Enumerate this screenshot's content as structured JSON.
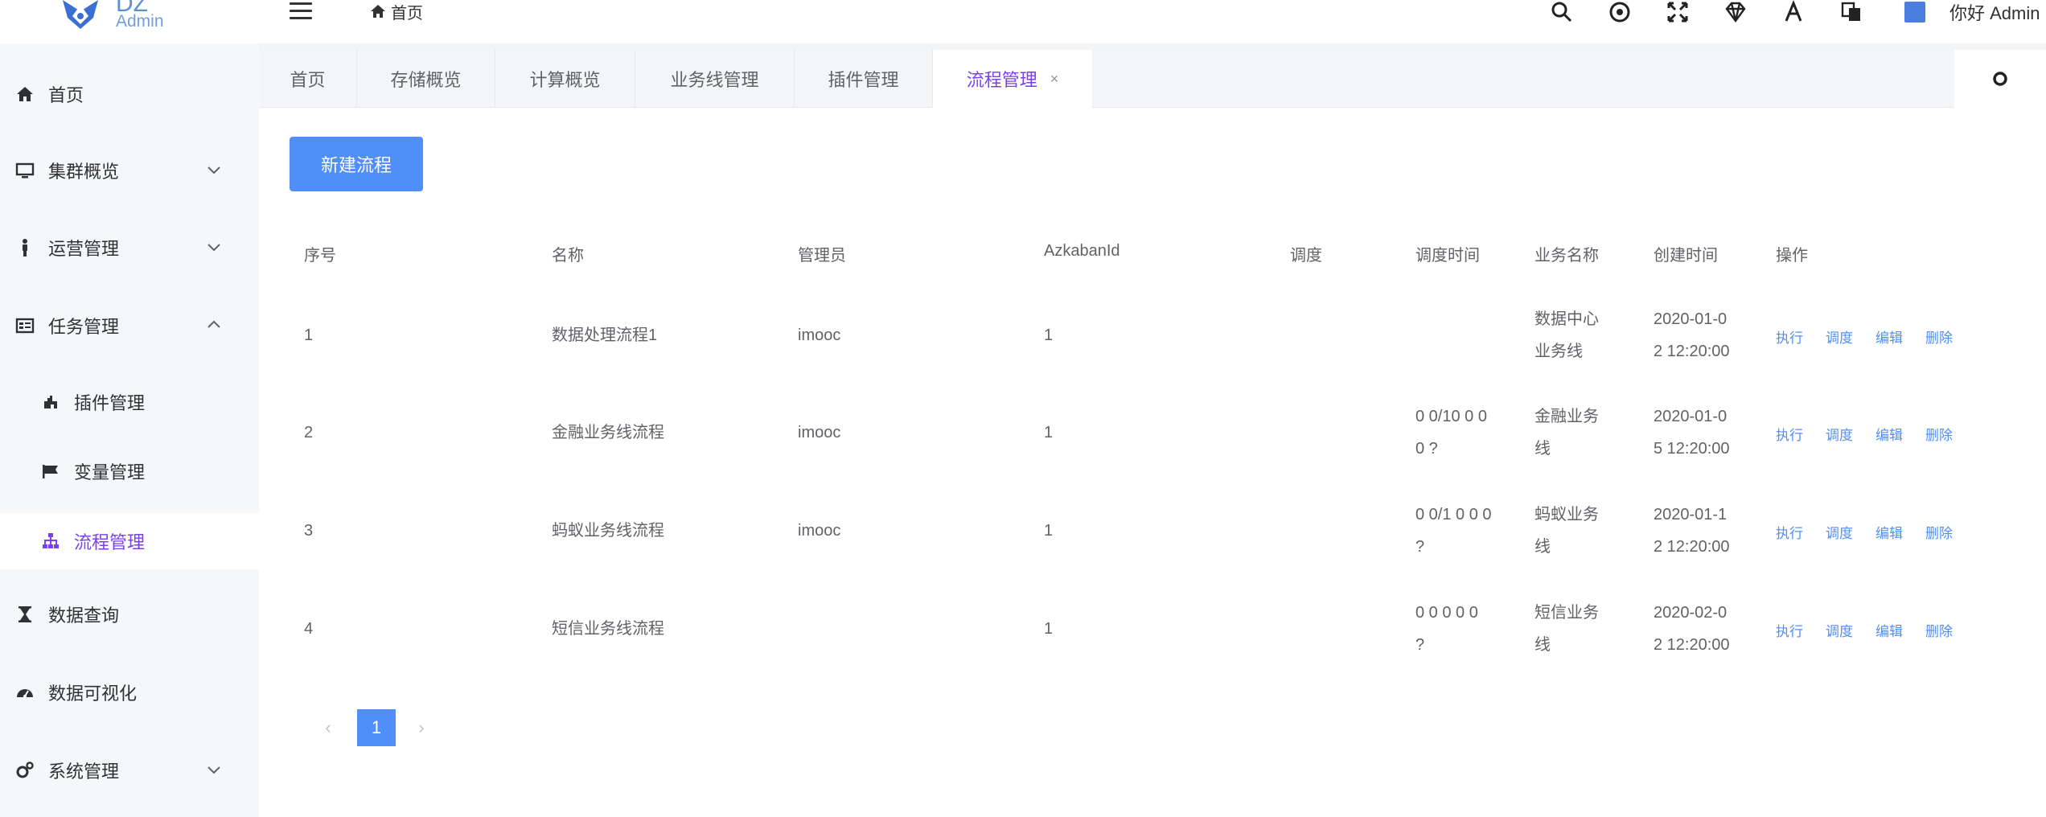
{
  "app": {
    "logo_text": "DZ",
    "logo_sub": "Admin",
    "breadcrumb": "首页",
    "greeting": "你好 Admin"
  },
  "topbar_icons": [
    "search-icon",
    "target-icon",
    "fullscreen-icon",
    "diamond-icon",
    "font-icon",
    "translate-icon"
  ],
  "sidebar": {
    "items": [
      {
        "label": "首页",
        "icon": "home-icon"
      },
      {
        "label": "集群概览",
        "icon": "monitor-icon",
        "arrow": "down"
      },
      {
        "label": "运营管理",
        "icon": "person-icon",
        "arrow": "down"
      },
      {
        "label": "任务管理",
        "icon": "task-icon",
        "arrow": "up"
      },
      {
        "label": "插件管理",
        "icon": "plugin-icon"
      },
      {
        "label": "变量管理",
        "icon": "flag-icon"
      },
      {
        "label": "流程管理",
        "icon": "sitemap-icon"
      },
      {
        "label": "数据查询",
        "icon": "hourglass-icon"
      },
      {
        "label": "数据可视化",
        "icon": "dashboard-icon"
      },
      {
        "label": "系统管理",
        "icon": "gears-icon",
        "arrow": "down"
      }
    ]
  },
  "tabs": [
    {
      "label": "首页"
    },
    {
      "label": "存储概览"
    },
    {
      "label": "计算概览"
    },
    {
      "label": "业务线管理"
    },
    {
      "label": "插件管理"
    },
    {
      "label": "流程管理",
      "close": "×"
    }
  ],
  "main": {
    "new_button": "新建流程",
    "table": {
      "headers": [
        "序号",
        "名称",
        "管理员",
        "AzkabanId",
        "调度",
        "调度时间",
        "业务名称",
        "创建时间",
        "操作"
      ],
      "rows": [
        {
          "id": "1",
          "name": "数据处理流程1",
          "admin": "imooc",
          "azkaban": "1",
          "schedule": "",
          "schedule_time_l1": "",
          "schedule_time_l2": "",
          "biz_l1": "数据中心",
          "biz_l2": "业务线",
          "created_l1": "2020-01-0",
          "created_l2": "2 12:20:00"
        },
        {
          "id": "2",
          "name": "金融业务线流程",
          "admin": "imooc",
          "azkaban": "1",
          "schedule": "",
          "schedule_time_l1": "0 0/10 0 0",
          "schedule_time_l2": "0 ?",
          "biz_l1": "金融业务",
          "biz_l2": "线",
          "created_l1": "2020-01-0",
          "created_l2": "5 12:20:00"
        },
        {
          "id": "3",
          "name": "蚂蚁业务线流程",
          "admin": "imooc",
          "azkaban": "1",
          "schedule": "",
          "schedule_time_l1": "0 0/1 0 0 0",
          "schedule_time_l2": "?",
          "biz_l1": "蚂蚁业务",
          "biz_l2": "线",
          "created_l1": "2020-01-1",
          "created_l2": "2 12:20:00"
        },
        {
          "id": "4",
          "name": "短信业务线流程",
          "admin": "",
          "azkaban": "1",
          "schedule": "",
          "schedule_time_l1": "0 0 0 0 0",
          "schedule_time_l2": "?",
          "biz_l1": "短信业务",
          "biz_l2": "线",
          "created_l1": "2020-02-0",
          "created_l2": "2 12:20:00"
        }
      ],
      "actions": [
        "执行",
        "调度",
        "编辑",
        "删除"
      ]
    },
    "pagination": {
      "prev": "‹",
      "current": "1",
      "next": "›"
    }
  },
  "colors": {
    "accent": "#4f8ff7",
    "active_menu": "#7b3ff2",
    "sidebar_bg": "#f6f7f9",
    "tabbar_bg": "#f4f5f7"
  }
}
